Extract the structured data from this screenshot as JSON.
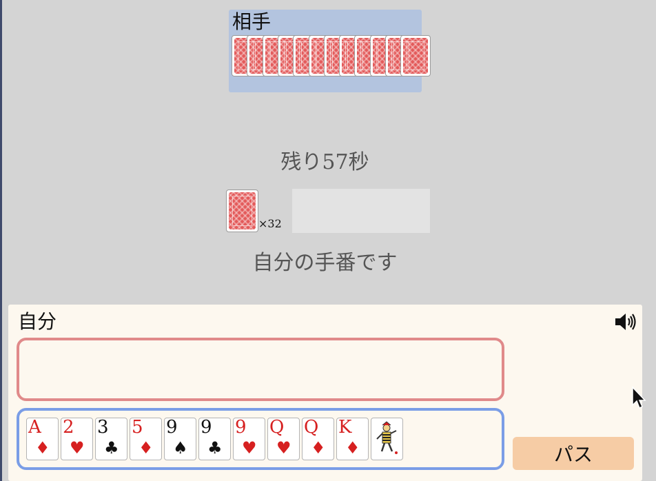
{
  "opponent": {
    "label": "相手",
    "card_count": 12
  },
  "timer": {
    "text": "残り57秒"
  },
  "deck": {
    "count_text": "×32"
  },
  "turn_status": "自分の手番です",
  "player": {
    "label": "自分",
    "hand": [
      {
        "rank": "A",
        "suit": "♦",
        "color": "red"
      },
      {
        "rank": "2",
        "suit": "♥",
        "color": "red"
      },
      {
        "rank": "3",
        "suit": "♣",
        "color": "black"
      },
      {
        "rank": "5",
        "suit": "♦",
        "color": "red"
      },
      {
        "rank": "9",
        "suit": "♠",
        "color": "black"
      },
      {
        "rank": "9",
        "suit": "♣",
        "color": "black"
      },
      {
        "rank": "9",
        "suit": "♥",
        "color": "red"
      },
      {
        "rank": "Q",
        "suit": "♥",
        "color": "red"
      },
      {
        "rank": "Q",
        "suit": "♦",
        "color": "red"
      },
      {
        "rank": "K",
        "suit": "♦",
        "color": "red"
      },
      {
        "rank": "",
        "suit": "",
        "color": "joker"
      }
    ],
    "pass_label": "パス",
    "sound_icon": "speaker-icon"
  },
  "colors": {
    "background": "#d4d4d4",
    "opponent_area": "#b3c4df",
    "player_area": "#fdf8ef",
    "play_zone_border": "#e08a8a",
    "hand_zone_border": "#7a9de6",
    "card_back": "#e35a5a",
    "pass_button": "#f6cca5",
    "suit_red": "#d62020"
  }
}
